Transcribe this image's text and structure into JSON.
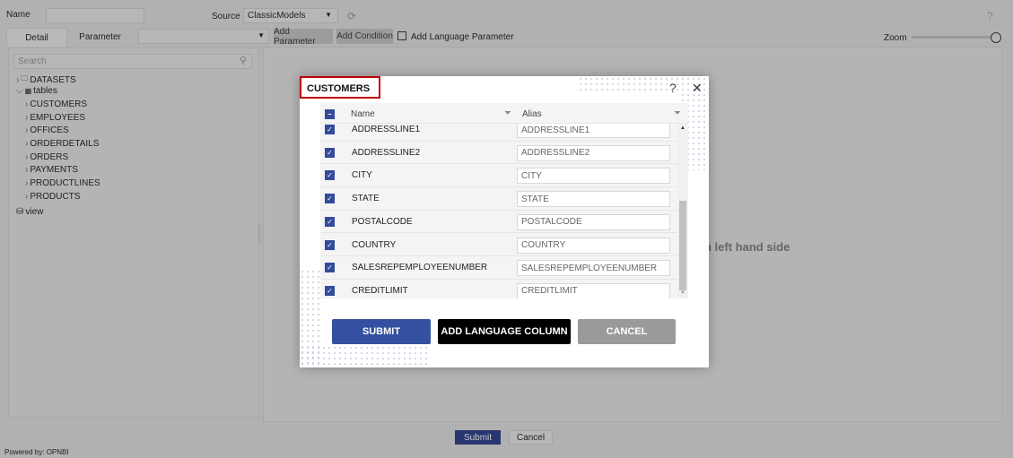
{
  "top": {
    "name_label": "Name",
    "name_value": "",
    "source_label": "Source",
    "source_value": "ClassicModels",
    "help": "?"
  },
  "toolbar": {
    "tabs": [
      "Detail",
      "Parameter"
    ],
    "param_select": "",
    "add_parameter": "Add Parameter",
    "add_condition": "Add Condition",
    "add_language_parameter": "Add Language Parameter",
    "zoom_label": "Zoom",
    "zoom_level": 1.0
  },
  "sidebar": {
    "search_placeholder": "Search",
    "items": [
      {
        "label": "DATASETS",
        "level": 0,
        "icon": "folder-icon"
      },
      {
        "label": "tables",
        "level": 0,
        "icon": "table-icon",
        "expanded": true
      },
      {
        "label": "CUSTOMERS",
        "level": 1
      },
      {
        "label": "EMPLOYEES",
        "level": 1
      },
      {
        "label": "OFFICES",
        "level": 1
      },
      {
        "label": "ORDERDETAILS",
        "level": 1
      },
      {
        "label": "ORDERS",
        "level": 1
      },
      {
        "label": "PAYMENTS",
        "level": 1
      },
      {
        "label": "PRODUCTLINES",
        "level": 1
      },
      {
        "label": "PRODUCTS",
        "level": 1
      },
      {
        "label": "view",
        "level": 0,
        "icon": "database-icon"
      }
    ]
  },
  "canvas": {
    "hint_visible": "n left hand side"
  },
  "footer": {
    "submit": "Submit",
    "cancel": "Cancel",
    "powered_by": "Powered by: OPNBI"
  },
  "modal": {
    "title": "CUSTOMERS",
    "help": "?",
    "close": "✕",
    "columns": {
      "name": "Name",
      "alias": "Alias"
    },
    "rows": [
      {
        "name": "ADDRESSLINE1",
        "alias": "ADDRESSLINE1",
        "checked": true
      },
      {
        "name": "ADDRESSLINE2",
        "alias": "ADDRESSLINE2",
        "checked": true
      },
      {
        "name": "CITY",
        "alias": "CITY",
        "checked": true
      },
      {
        "name": "STATE",
        "alias": "STATE",
        "checked": true
      },
      {
        "name": "POSTALCODE",
        "alias": "POSTALCODE",
        "checked": true
      },
      {
        "name": "COUNTRY",
        "alias": "COUNTRY",
        "checked": true
      },
      {
        "name": "SALESREPEMPLOYEENUMBER",
        "alias": "SALESREPEMPLOYEENUMBER",
        "checked": true
      },
      {
        "name": "CREDITLIMIT",
        "alias": "CREDITLIMIT",
        "checked": true
      }
    ],
    "buttons": {
      "submit": "SUBMIT",
      "add_language_column": "ADD LANGUAGE COLUMN",
      "cancel": "CANCEL"
    },
    "colors": {
      "submit": "#3450a0",
      "add_language": "#000000",
      "cancel": "#9a9a9a",
      "title_border": "#c00000"
    }
  }
}
